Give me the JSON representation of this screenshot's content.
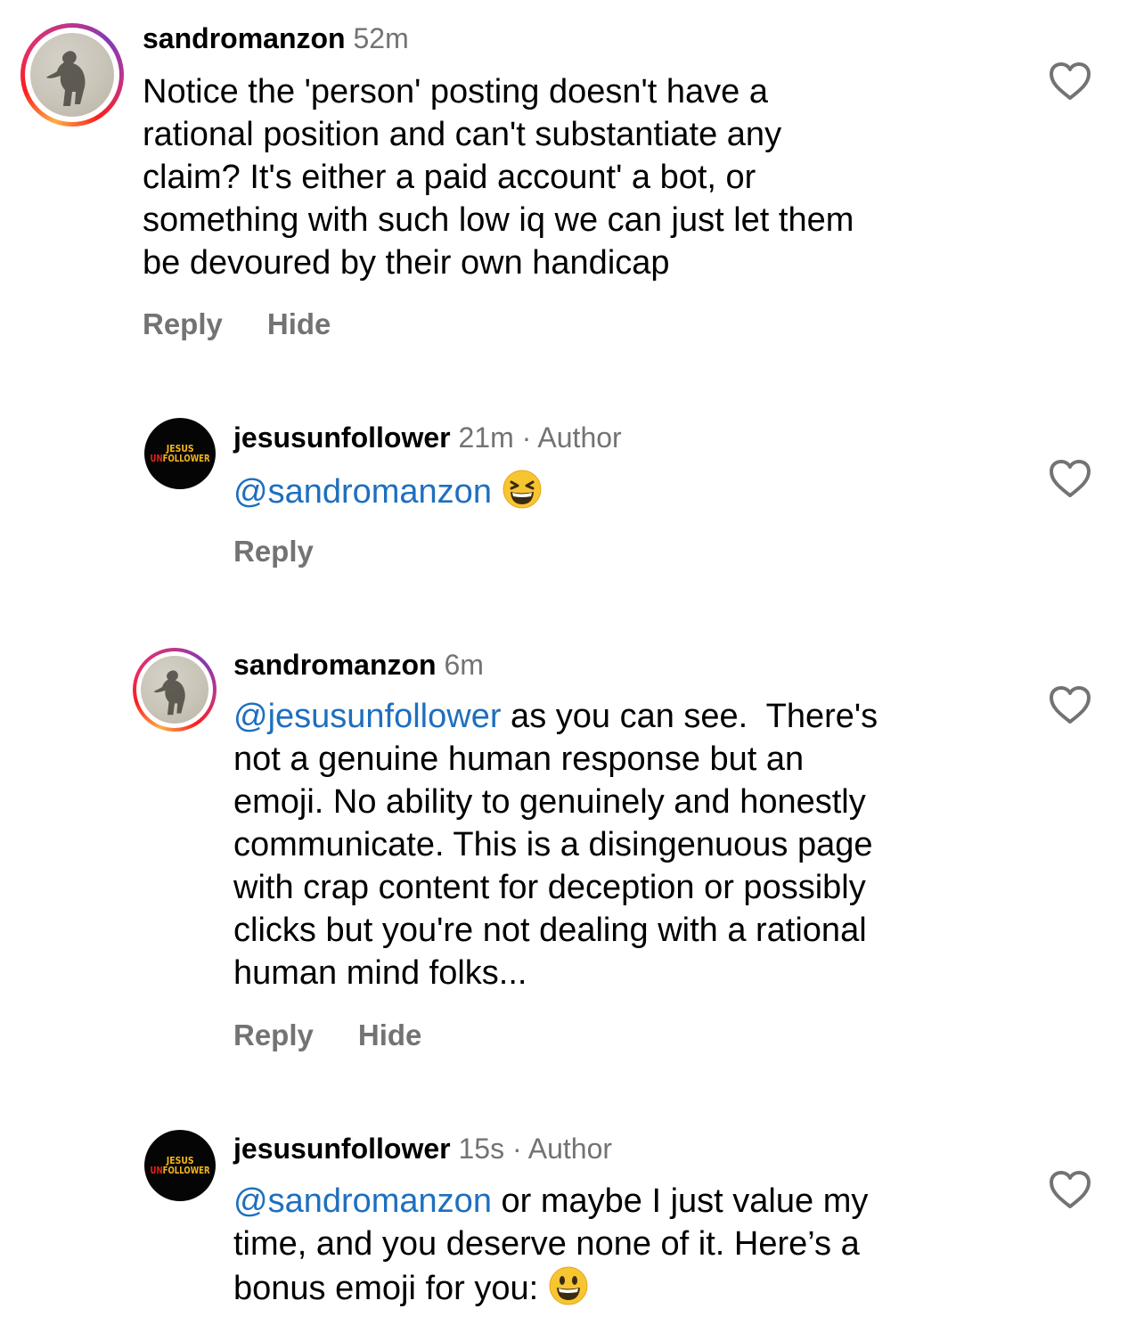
{
  "comments": [
    {
      "username": "sandromanzon",
      "time": "52m",
      "author_tag": "",
      "mention": "",
      "text": "Notice the 'person' posting doesn't have a rational position and can't substantiate any claim?  It's either a paid account' a bot, or something with such low iq we can just let them be devoured by their own handicap",
      "lines": [
        "Notice the 'person' posting doesn't have a",
        "rational position and can't substantiate any",
        "claim?  It's either a paid account' a bot, or",
        "something with such low iq we can just let them",
        "be devoured by their own handicap"
      ],
      "reply_label": "Reply",
      "hide_label": "Hide"
    },
    {
      "username": "jesusunfollower",
      "time": "21m",
      "author_tag": "· Author",
      "mention": "@sandromanzon",
      "emoji": "grinning-squinting-face",
      "reply_label": "Reply",
      "avatar_text": {
        "line1": "JESUS",
        "line2_red": "UN",
        "line2": "FOLLOWER"
      }
    },
    {
      "username": "sandromanzon",
      "time": "6m",
      "mention": "@jesusunfollower",
      "lines": [
        " as you can see.  There's",
        "not a genuine human response but an",
        "emoji.  No ability to genuinely and honestly",
        "communicate.  This is a disingenuous page",
        "with crap content for deception or possibly",
        "clicks but you're not dealing with a rational",
        "human mind folks..."
      ],
      "reply_label": "Reply",
      "hide_label": "Hide"
    },
    {
      "username": "jesusunfollower",
      "time": "15s",
      "author_tag": "· Author",
      "mention": "@sandromanzon",
      "lines": [
        " or maybe I just value my",
        "time, and you deserve none of it. Here’s a",
        "bonus emoji for you: "
      ],
      "emoji": "smiling-face-open-mouth",
      "avatar_text": {
        "line1": "JESUS",
        "line2_red": "UN",
        "line2": "FOLLOWER"
      }
    }
  ],
  "colors": {
    "mention": "#1e6fbf",
    "meta": "#737373",
    "brand_yellow": "#f5b51b",
    "brand_red": "#e2231a"
  },
  "icons": [
    "heart-outline-icon",
    "grinning-squinting-face-emoji",
    "smiling-face-emoji"
  ]
}
